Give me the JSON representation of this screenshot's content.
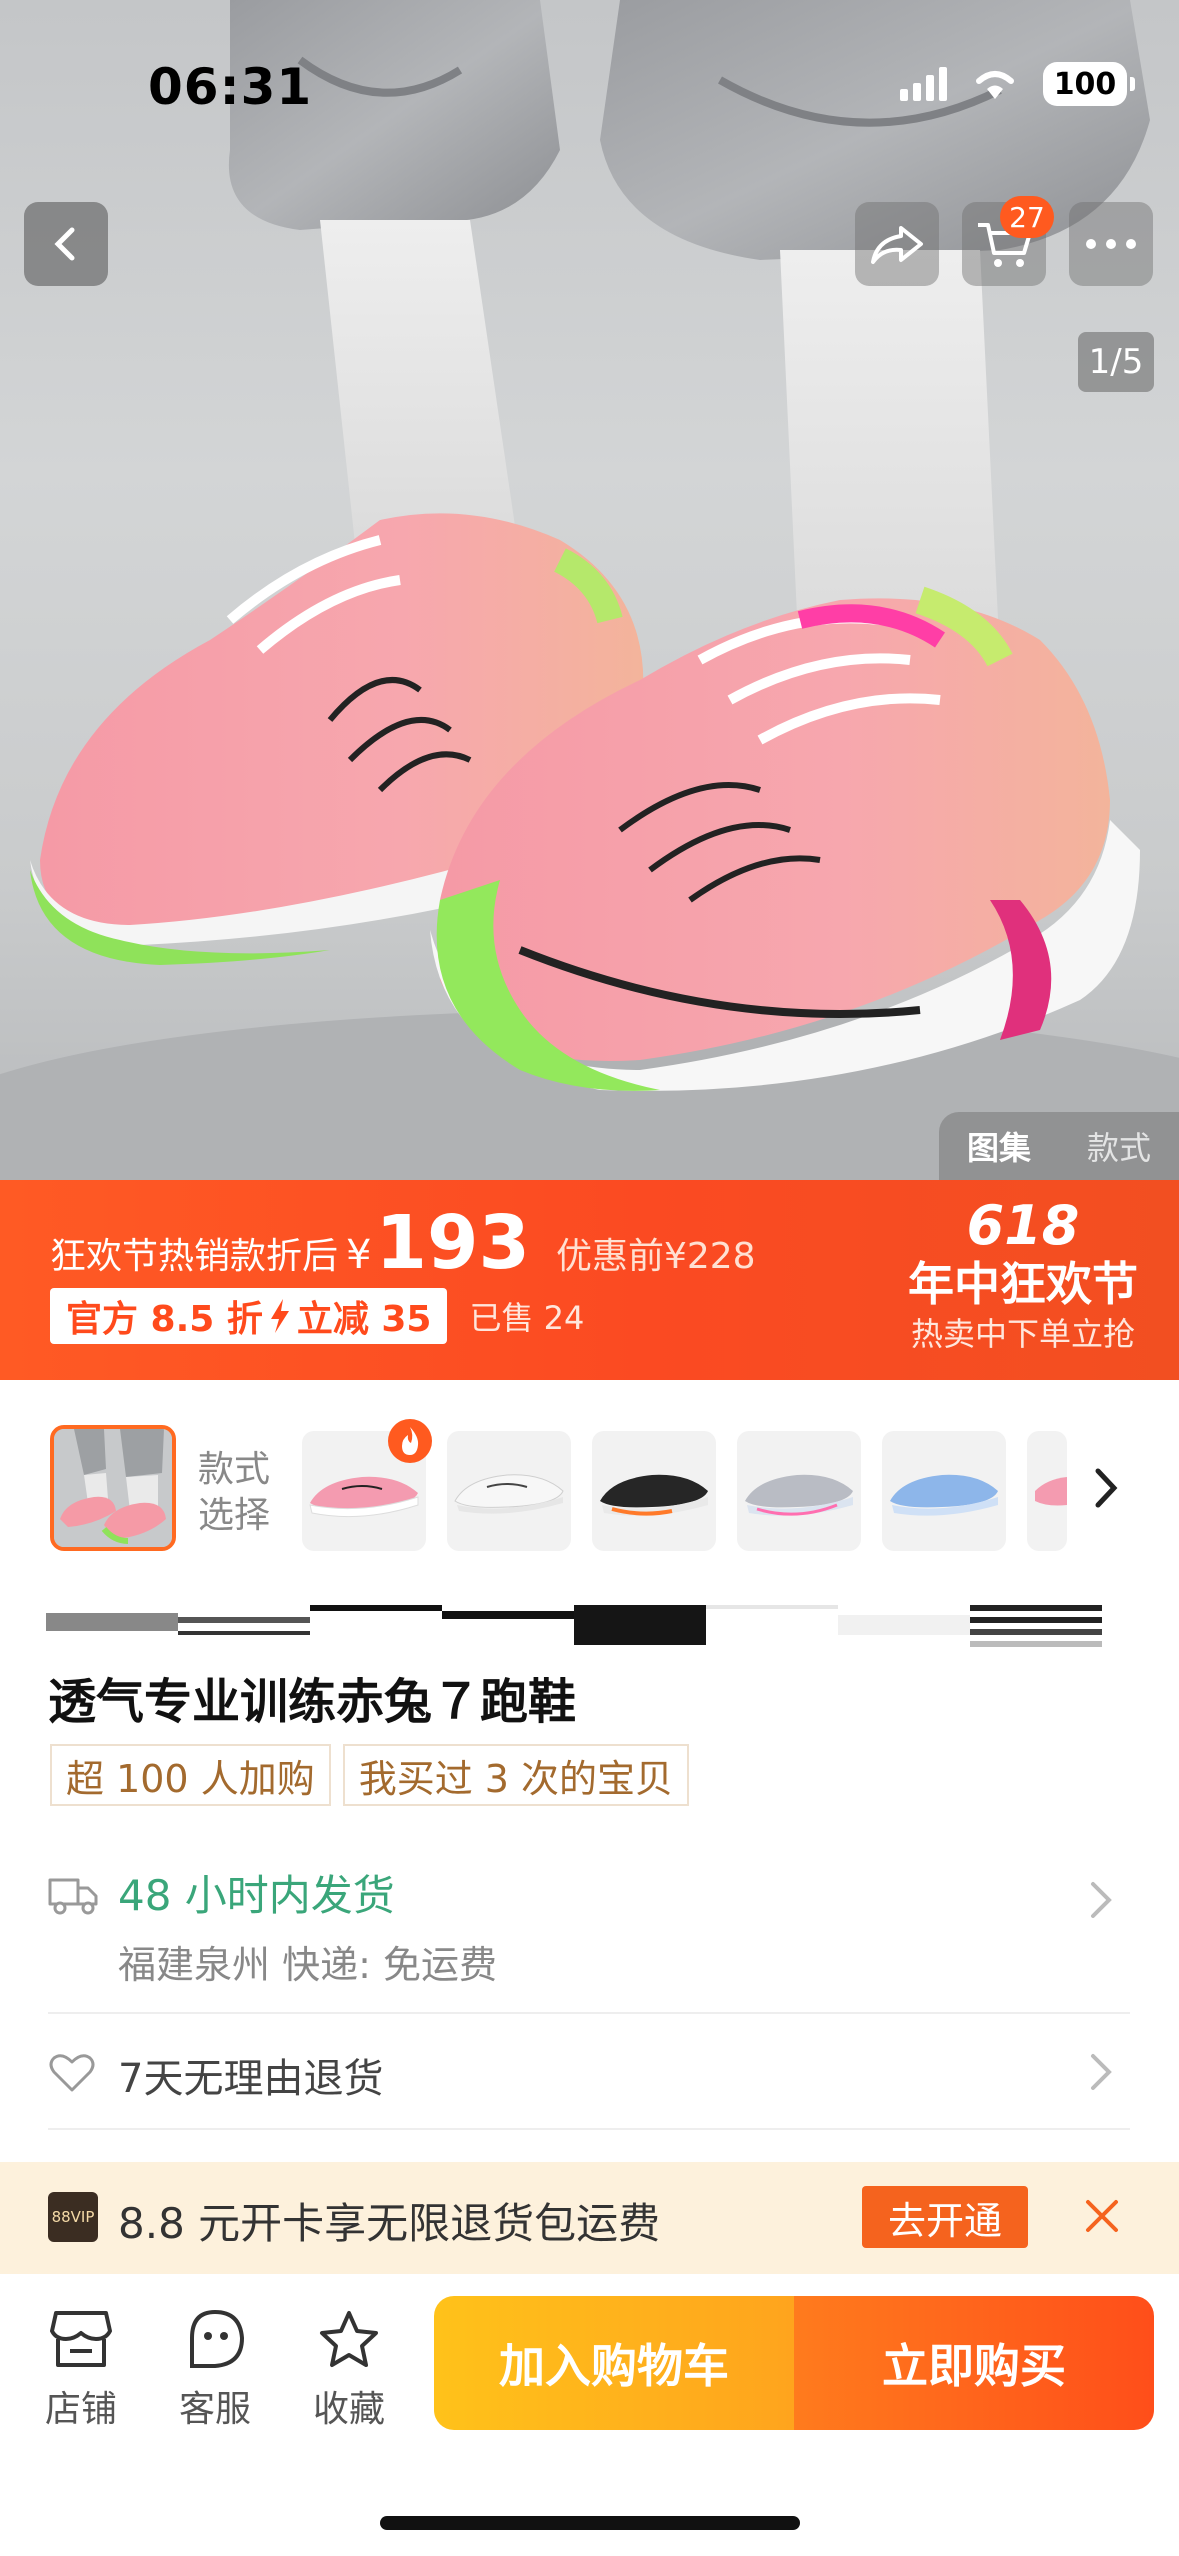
{
  "status_bar": {
    "time": "06:31",
    "battery": "100"
  },
  "nav": {
    "cart_count": "27",
    "image_counter": "1/5"
  },
  "gallery_tabs": [
    "图集",
    "款式"
  ],
  "price_banner": {
    "promo_label": "狂欢节热销款折后",
    "currency": "¥",
    "price": "193",
    "original_price": "优惠前¥228",
    "discount_left": "官方 8.5 折",
    "discount_right": "立减 35",
    "sold": "已售 24",
    "festival_number": "618",
    "festival_title": "年中狂欢节",
    "festival_sub": "热卖中下单立抢"
  },
  "style_selector": {
    "label": "款式选择"
  },
  "product": {
    "title": "透气专业训练赤兔７跑鞋",
    "tags": [
      "超 100 人加购",
      "我买过 3 次的宝贝"
    ]
  },
  "shipping": {
    "title": "48 小时内发货",
    "detail": "福建泉州  快递: 免运费"
  },
  "returns": {
    "text": "7天无理由退货"
  },
  "vip": {
    "logo": "88VIP",
    "text": "8.8 元开卡享无限退货包运费",
    "button": "去开通"
  },
  "bottom_bar": {
    "store": "店铺",
    "service": "客服",
    "favorite": "收藏",
    "add_to_cart": "加入购物车",
    "buy_now": "立即购买"
  },
  "colors": {
    "accent": "#ff5a24",
    "green": "#3aa67a",
    "gold": "#a36a2e"
  }
}
